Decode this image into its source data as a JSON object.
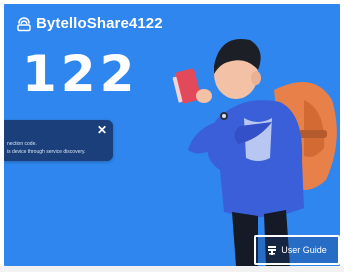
{
  "app": {
    "device_name": "BytelloShare4122",
    "connection_code": "122"
  },
  "toast": {
    "line1": "nection code.",
    "line2": "is device through service discovery.",
    "close_symbol": "✕"
  },
  "guide_button": {
    "label": "User Guide"
  },
  "icons": {
    "header": "share-icon",
    "guide": "user-guide-icon",
    "toast_close": "close-icon"
  },
  "colors": {
    "background": "#2f86ee",
    "toast": "#1a3f7a",
    "text": "#ffffff"
  }
}
